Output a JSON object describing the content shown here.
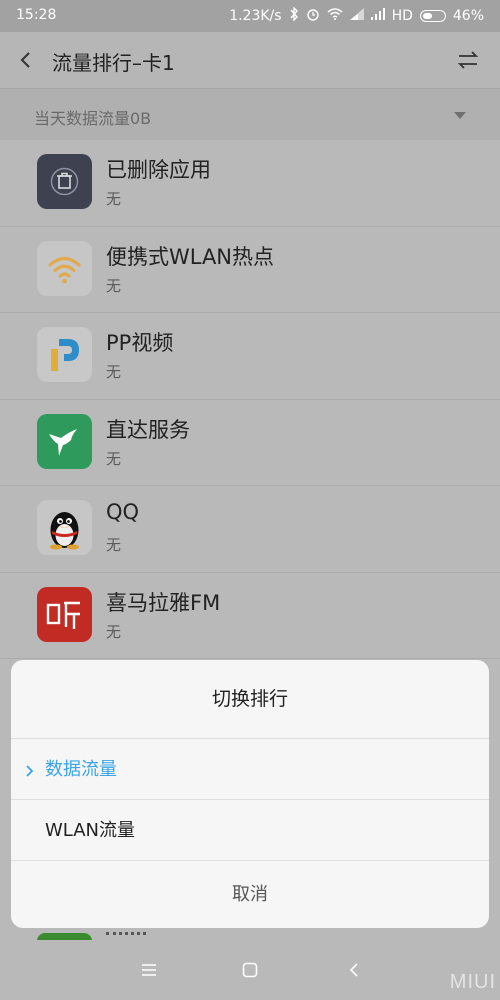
{
  "status_bar": {
    "time": "15:28",
    "net_speed": "1.23K/s",
    "hd_label": "HD",
    "battery": "46%",
    "battery_level": 0.46
  },
  "header": {
    "title": "流量排行–卡1"
  },
  "filter": {
    "label": "当天数据流量0B"
  },
  "apps": [
    {
      "name": "已删除应用",
      "usage": "无",
      "icon": "trash-icon",
      "icon_color": "#3e4150"
    },
    {
      "name": "便携式WLAN热点",
      "usage": "无",
      "icon": "wifi-hotspot-icon",
      "icon_color": "#e0a94a"
    },
    {
      "name": "PP视频",
      "usage": "无",
      "icon": "pp-video-icon",
      "icon_color": "#2f8ec9"
    },
    {
      "name": "直达服务",
      "usage": "无",
      "icon": "hummingbird-icon",
      "icon_color": "#2e9a5c"
    },
    {
      "name": "QQ",
      "usage": "无",
      "icon": "qq-penguin-icon",
      "icon_color": "#111111"
    },
    {
      "name": "喜马拉雅FM",
      "usage": "无",
      "icon": "ximalaya-icon",
      "icon_color": "#d23a2c"
    }
  ],
  "dialog": {
    "title": "切换排行",
    "options": [
      {
        "label": "数据流量",
        "selected": true
      },
      {
        "label": "WLAN流量",
        "selected": false
      }
    ],
    "cancel_label": "取消",
    "accent_color": "#3aa4e8"
  },
  "nav": {
    "brand": "MIUI"
  }
}
